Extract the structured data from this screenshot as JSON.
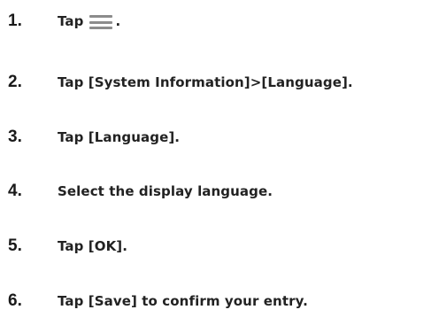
{
  "steps": [
    {
      "number": "1.",
      "text_before": "Tap",
      "icon": "hamburger-menu-icon",
      "text_after": "."
    },
    {
      "number": "2.",
      "text": "Tap [System Information]>[Language]."
    },
    {
      "number": "3.",
      "text": "Tap [Language]."
    },
    {
      "number": "4.",
      "text": "Select the display language."
    },
    {
      "number": "5.",
      "text": "Tap [OK]."
    },
    {
      "number": "6.",
      "text": "Tap [Save] to confirm your entry."
    }
  ]
}
